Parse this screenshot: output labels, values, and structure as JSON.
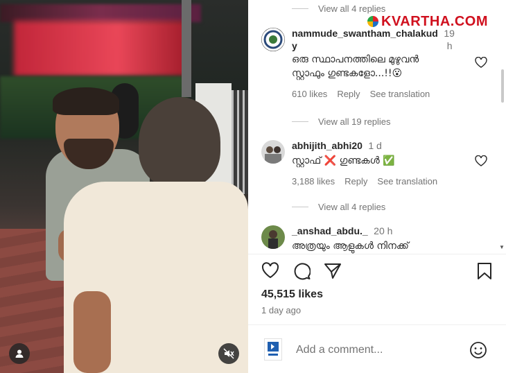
{
  "watermark": {
    "brand": "KVARTHA.COM"
  },
  "top_replies": {
    "label": "View all 4 replies"
  },
  "comments": [
    {
      "username": "nammude_swantham_chalakud",
      "username_tail": "y",
      "time": "19",
      "time_unit": "h",
      "text_line1": "ഒരു സ്ഥാപനത്തിലെ മുഴുവൻ",
      "text_line2": "സ്റ്റാഫും ഗുണ്ടകളോ...!!😮",
      "likes": "610 likes",
      "reply": "Reply",
      "translate": "See translation",
      "replies": "View all 19 replies"
    },
    {
      "username": "abhijith_abhi20",
      "time": "1 d",
      "text_line1": "സ്റ്റാഫ് ❌ ഗുണ്ടകൾ ✅",
      "likes": "3,188 likes",
      "reply": "Reply",
      "translate": "See translation",
      "replies": "View all 4 replies"
    },
    {
      "username": "_anshad_abdu._",
      "time": "20 h",
      "text_line1": "അത്രയും ആളുകൾ നിനക്ക്"
    }
  ],
  "post": {
    "likes": "45,515 likes",
    "time_ago": "1 day ago"
  },
  "add_comment": {
    "placeholder": "Add a comment..."
  },
  "icons": {
    "like": "heart-icon",
    "comment": "comment-icon",
    "share": "send-icon",
    "save": "bookmark-icon",
    "emoji": "smiley-icon",
    "mute": "muted-speaker-icon",
    "tags": "user-icon"
  }
}
